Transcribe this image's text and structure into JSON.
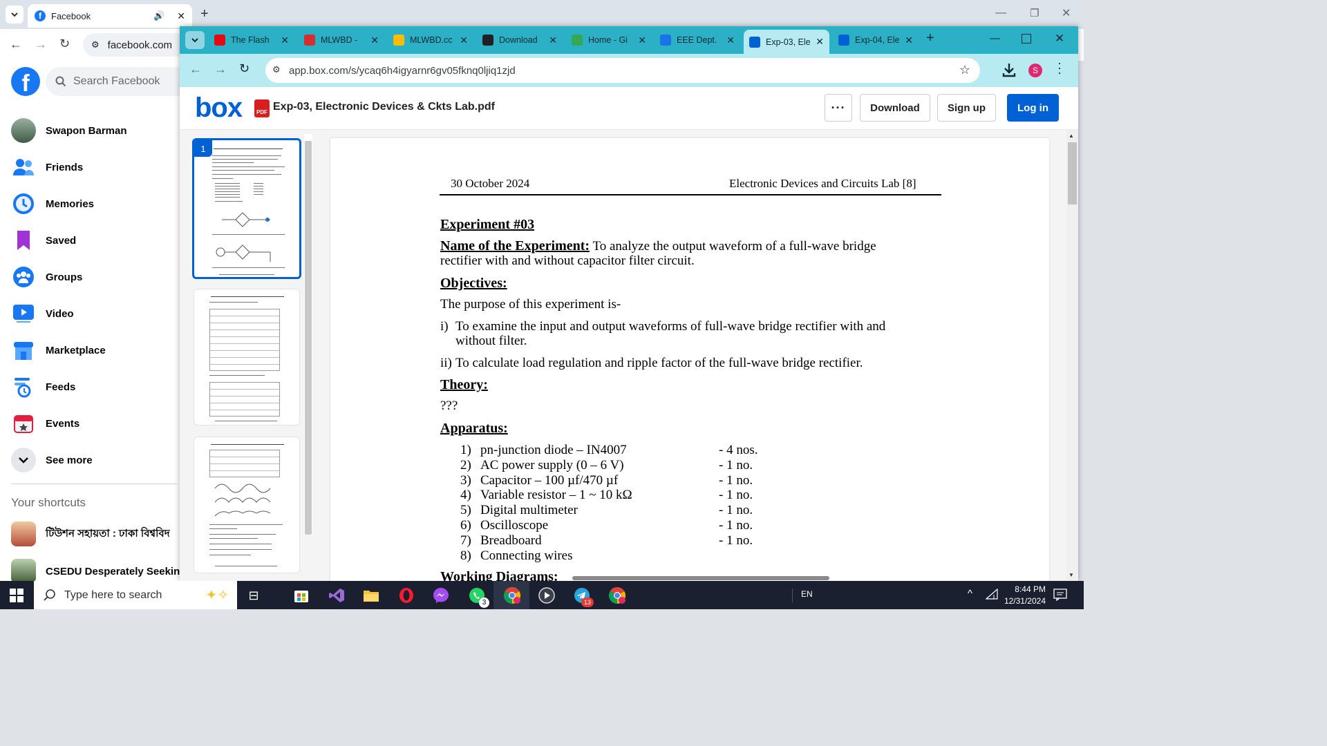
{
  "back_window": {
    "tab": {
      "title": "Facebook",
      "url": "facebook.com"
    },
    "facebook": {
      "search_placeholder": "Search Facebook",
      "nav": [
        {
          "label": "Swapon Barman",
          "icon": "profile-avatar"
        },
        {
          "label": "Friends",
          "icon": "friends-icon"
        },
        {
          "label": "Memories",
          "icon": "memories-clock-icon"
        },
        {
          "label": "Saved",
          "icon": "saved-bookmark-icon"
        },
        {
          "label": "Groups",
          "icon": "groups-icon"
        },
        {
          "label": "Video",
          "icon": "video-play-icon"
        },
        {
          "label": "Marketplace",
          "icon": "marketplace-store-icon"
        },
        {
          "label": "Feeds",
          "icon": "feeds-icon"
        },
        {
          "label": "Events",
          "icon": "events-calendar-icon"
        },
        {
          "label": "See more",
          "icon": "chevron-down-icon"
        }
      ],
      "shortcuts_title": "Your shortcuts",
      "shortcuts": [
        "টিউশন সহায়তা : ঢাকা বিশ্ববিদ",
        "CSEDU Desperately Seeking"
      ]
    }
  },
  "front_window": {
    "tabs": [
      {
        "title": "The Flash",
        "color": "#e50914",
        "active": false
      },
      {
        "title": "MLWBD - ",
        "color": "#d32f2f",
        "active": false
      },
      {
        "title": "MLWBD.cc",
        "color": "#fbbc04",
        "active": false
      },
      {
        "title": "Download",
        "color": "#202124",
        "active": false
      },
      {
        "title": "Home - Gi",
        "color": "#34a853",
        "active": false
      },
      {
        "title": "EEE Dept.",
        "color": "#1a73e8",
        "active": false
      },
      {
        "title": "Exp-03, Ele",
        "color": "#0061d5",
        "active": true
      },
      {
        "title": "Exp-04, Ele",
        "color": "#0061d5",
        "active": false
      }
    ],
    "url": "app.box.com/s/ycaq6h4igyarnr6gv05fknq0ljiq1zjd",
    "profile_initial": "S",
    "box": {
      "logo": "box",
      "file_badge": "PDF",
      "file_name": "Exp-03, Electronic Devices & Ckts Lab.pdf",
      "more_label": "···",
      "download_label": "Download",
      "signup_label": "Sign up",
      "login_label": "Log in",
      "current_page": "1"
    },
    "document": {
      "date": "30 October 2024",
      "course": "Electronic Devices and Circuits Lab [8]",
      "experiment": "Experiment #03",
      "name_label": "Name of the Experiment:",
      "name_text_1": " To analyze the output waveform of a full-wave bridge",
      "name_text_2": "rectifier with and without capacitor filter circuit.",
      "objectives_label": "Objectives:",
      "objectives_intro": "The purpose of this experiment is-",
      "obj1_num": "i)",
      "obj1_line1": "To examine the input and output waveforms of full-wave bridge rectifier with and",
      "obj1_line2": "without filter.",
      "obj2_num": "ii)",
      "obj2_text": "To calculate load regulation and ripple factor of the full-wave bridge rectifier.",
      "theory_label": "Theory:",
      "theory_text": "???",
      "apparatus_label": "Apparatus:",
      "apparatus": [
        {
          "num": "1)",
          "item": "pn-junction diode – IN4007",
          "qty": "- 4 nos."
        },
        {
          "num": "2)",
          "item": "AC power supply (0 – 6 V)",
          "qty": "- 1 no."
        },
        {
          "num": "3)",
          "item": "Capacitor – 100 µf/470 µf",
          "qty": "- 1 no."
        },
        {
          "num": "4)",
          "item": "Variable resistor – 1 ~ 10 kΩ",
          "qty": "- 1 no."
        },
        {
          "num": "5)",
          "item": "Digital multimeter",
          "qty": "- 1 no."
        },
        {
          "num": "6)",
          "item": "Oscilloscope",
          "qty": "- 1 no."
        },
        {
          "num": "7)",
          "item": "Breadboard",
          "qty": "- 1 no."
        },
        {
          "num": "8)",
          "item": "Connecting wires",
          "qty": ""
        }
      ],
      "working_label": "Working Diagrams:"
    }
  },
  "taskbar": {
    "search_placeholder": "Type here to search",
    "whatsapp_badge": "3",
    "telegram_badge": "13",
    "language": "EN",
    "time": "8:44 PM",
    "date": "12/31/2024"
  }
}
